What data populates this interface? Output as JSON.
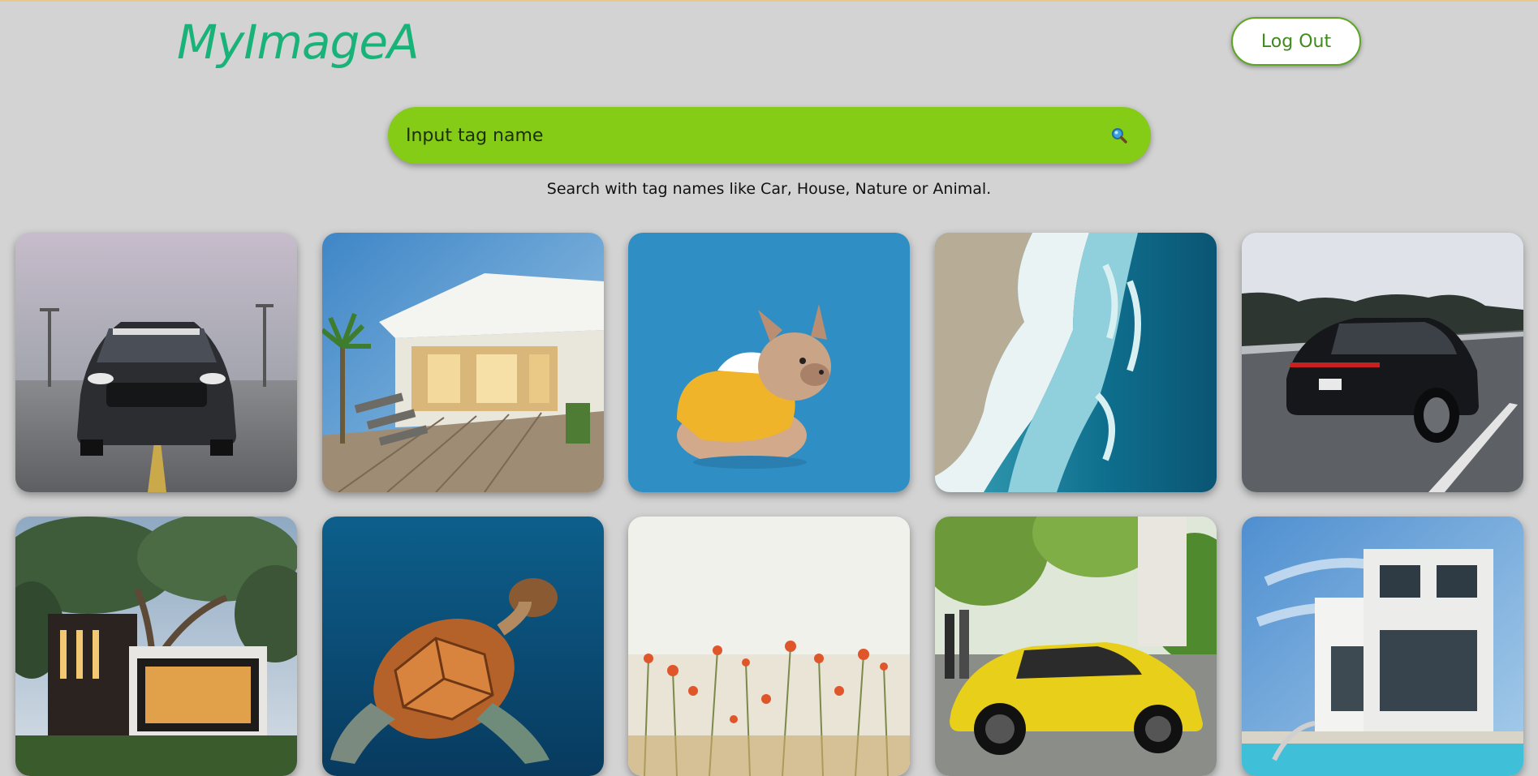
{
  "header": {
    "logo": "MyImageA",
    "logout_label": "Log Out"
  },
  "search": {
    "placeholder": "Input tag name",
    "icon": "magnifier-icon",
    "hint": "Search with tag names like Car, House, Nature or Animal."
  },
  "gallery": {
    "images": [
      {
        "subject": "black-muscle-car-front"
      },
      {
        "subject": "house-patio-deck"
      },
      {
        "subject": "dog-in-yellow-hoodie"
      },
      {
        "subject": "ocean-waves-beach"
      },
      {
        "subject": "black-sports-car-road"
      },
      {
        "subject": "modern-house-trees"
      },
      {
        "subject": "sea-turtle"
      },
      {
        "subject": "poppy-field"
      },
      {
        "subject": "yellow-sports-car"
      },
      {
        "subject": "white-villa-pool"
      }
    ]
  },
  "colors": {
    "background": "#d3d3d3",
    "logo": "#19b37a",
    "search_bar": "#84cc16",
    "logout_border": "#5ca525"
  }
}
